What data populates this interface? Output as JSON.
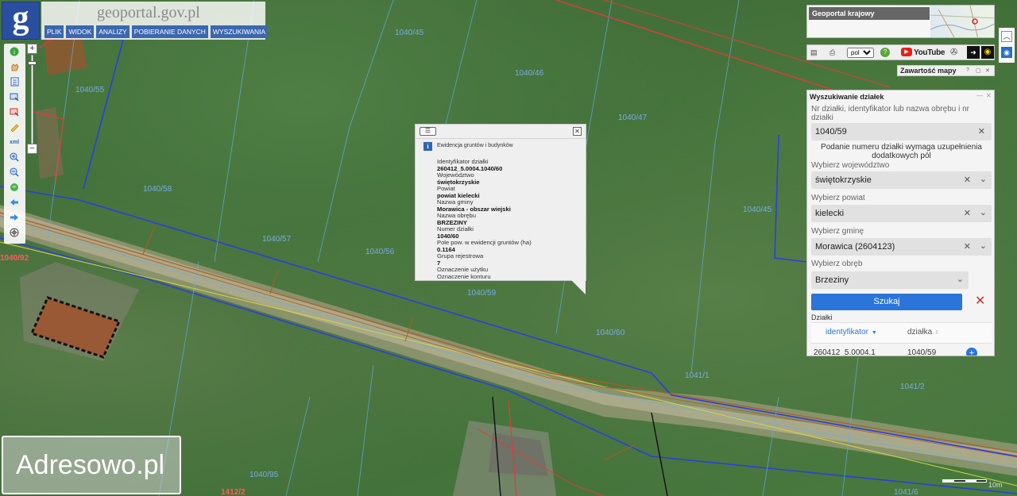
{
  "header": {
    "logo_letter": "g",
    "brand": "geoportal.gov.pl",
    "menu": [
      "PLIK",
      "WIDOK",
      "ANALIZY",
      "POBIERANIE DANYCH",
      "WYSZUKIWANIA"
    ]
  },
  "map": {
    "parcel_labels": [
      "1040/45",
      "1040/46",
      "1040/47",
      "1040/45",
      "1040/58",
      "1040/57",
      "1040/56",
      "1040/59",
      "1040/60",
      "1041/1",
      "1041/2",
      "1040/55",
      "1040/92",
      "1040/95",
      "1041/6",
      "1412/2"
    ]
  },
  "popup": {
    "list_icon": "list-icon",
    "close_symbol": "✕",
    "layer_title": "Ewidencja gruntów i budynków",
    "fields": [
      {
        "label": "Identyfikator działki",
        "value": "260412_5.0004.1040/60"
      },
      {
        "label": "Województwo",
        "value": "świętokrzyskie"
      },
      {
        "label": "Powiat",
        "value": "powiat kielecki"
      },
      {
        "label": "Nazwa gminy",
        "value": "Morawica - obszar wiejski"
      },
      {
        "label": "Nazwa obrębu",
        "value": "BRZEZINY"
      },
      {
        "label": "Numer działki",
        "value": "1040/60"
      },
      {
        "label": "Pole pow. w ewidencji gruntów (ha)",
        "value": "0.1164"
      },
      {
        "label": "Grupa rejestrowa",
        "value": "7"
      },
      {
        "label": "Oznaczenie użytku",
        "value": ""
      },
      {
        "label": "Oznaczenie konturu",
        "value": ""
      }
    ]
  },
  "overview": {
    "title": "Geoportal krajowy"
  },
  "tools": {
    "language": "pol",
    "youtube_label": "YouTube"
  },
  "contents": {
    "label": "Zawartość mapy"
  },
  "search_panel": {
    "title": "Wyszukiwanie działek",
    "parcel_label": "Nr działki, identyfikator lub nazwa obrębu i nr działki",
    "parcel_value": "1040/59",
    "hint": "Podanie numeru działki wymaga uzupełnienia dodatkowych pól",
    "voivodeship_label": "Wybierz województwo",
    "voivodeship_value": "świętokrzyskie",
    "county_label": "Wybierz powiat",
    "county_value": "kielecki",
    "commune_label": "Wybierz gminę",
    "commune_value": "Morawica (2604123)",
    "precinct_label": "Wybierz obręb",
    "precinct_value": "Brzeziny",
    "search_button": "Szukaj",
    "results_title": "Działki",
    "columns": [
      "identyfikator",
      "działka"
    ],
    "rows": [
      {
        "id": "260412_5.0004.1",
        "parcel": "1040/59"
      }
    ]
  },
  "watermark": "Adresowo.pl",
  "scale_label": "10m"
}
